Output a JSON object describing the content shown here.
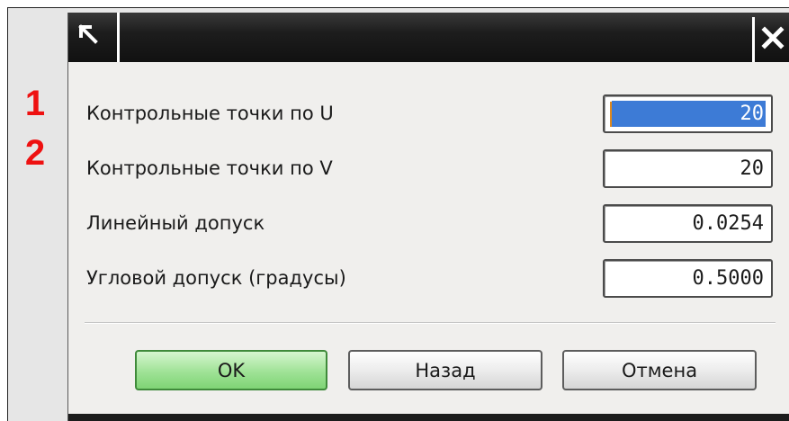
{
  "markers": [
    "1",
    "2"
  ],
  "dialog": {
    "title_icon": "pointer-arrow-icon",
    "close_icon": "close-icon",
    "fields": [
      {
        "label": "Контрольные точки по U",
        "value": "20",
        "focused": true
      },
      {
        "label": "Контрольные точки по V",
        "value": "20"
      },
      {
        "label": "Линейный допуск",
        "value": "0.0254"
      },
      {
        "label": "Угловой допуск (градусы)",
        "value": "0.5000"
      }
    ],
    "buttons": {
      "ok": "OK",
      "back": "Назад",
      "cancel": "Отмена"
    }
  },
  "colors": {
    "marker": "#ee1111",
    "focus_highlight": "#3d7bd6",
    "ok_button": "#9fe296",
    "title_bar": "#1d1d1d"
  }
}
